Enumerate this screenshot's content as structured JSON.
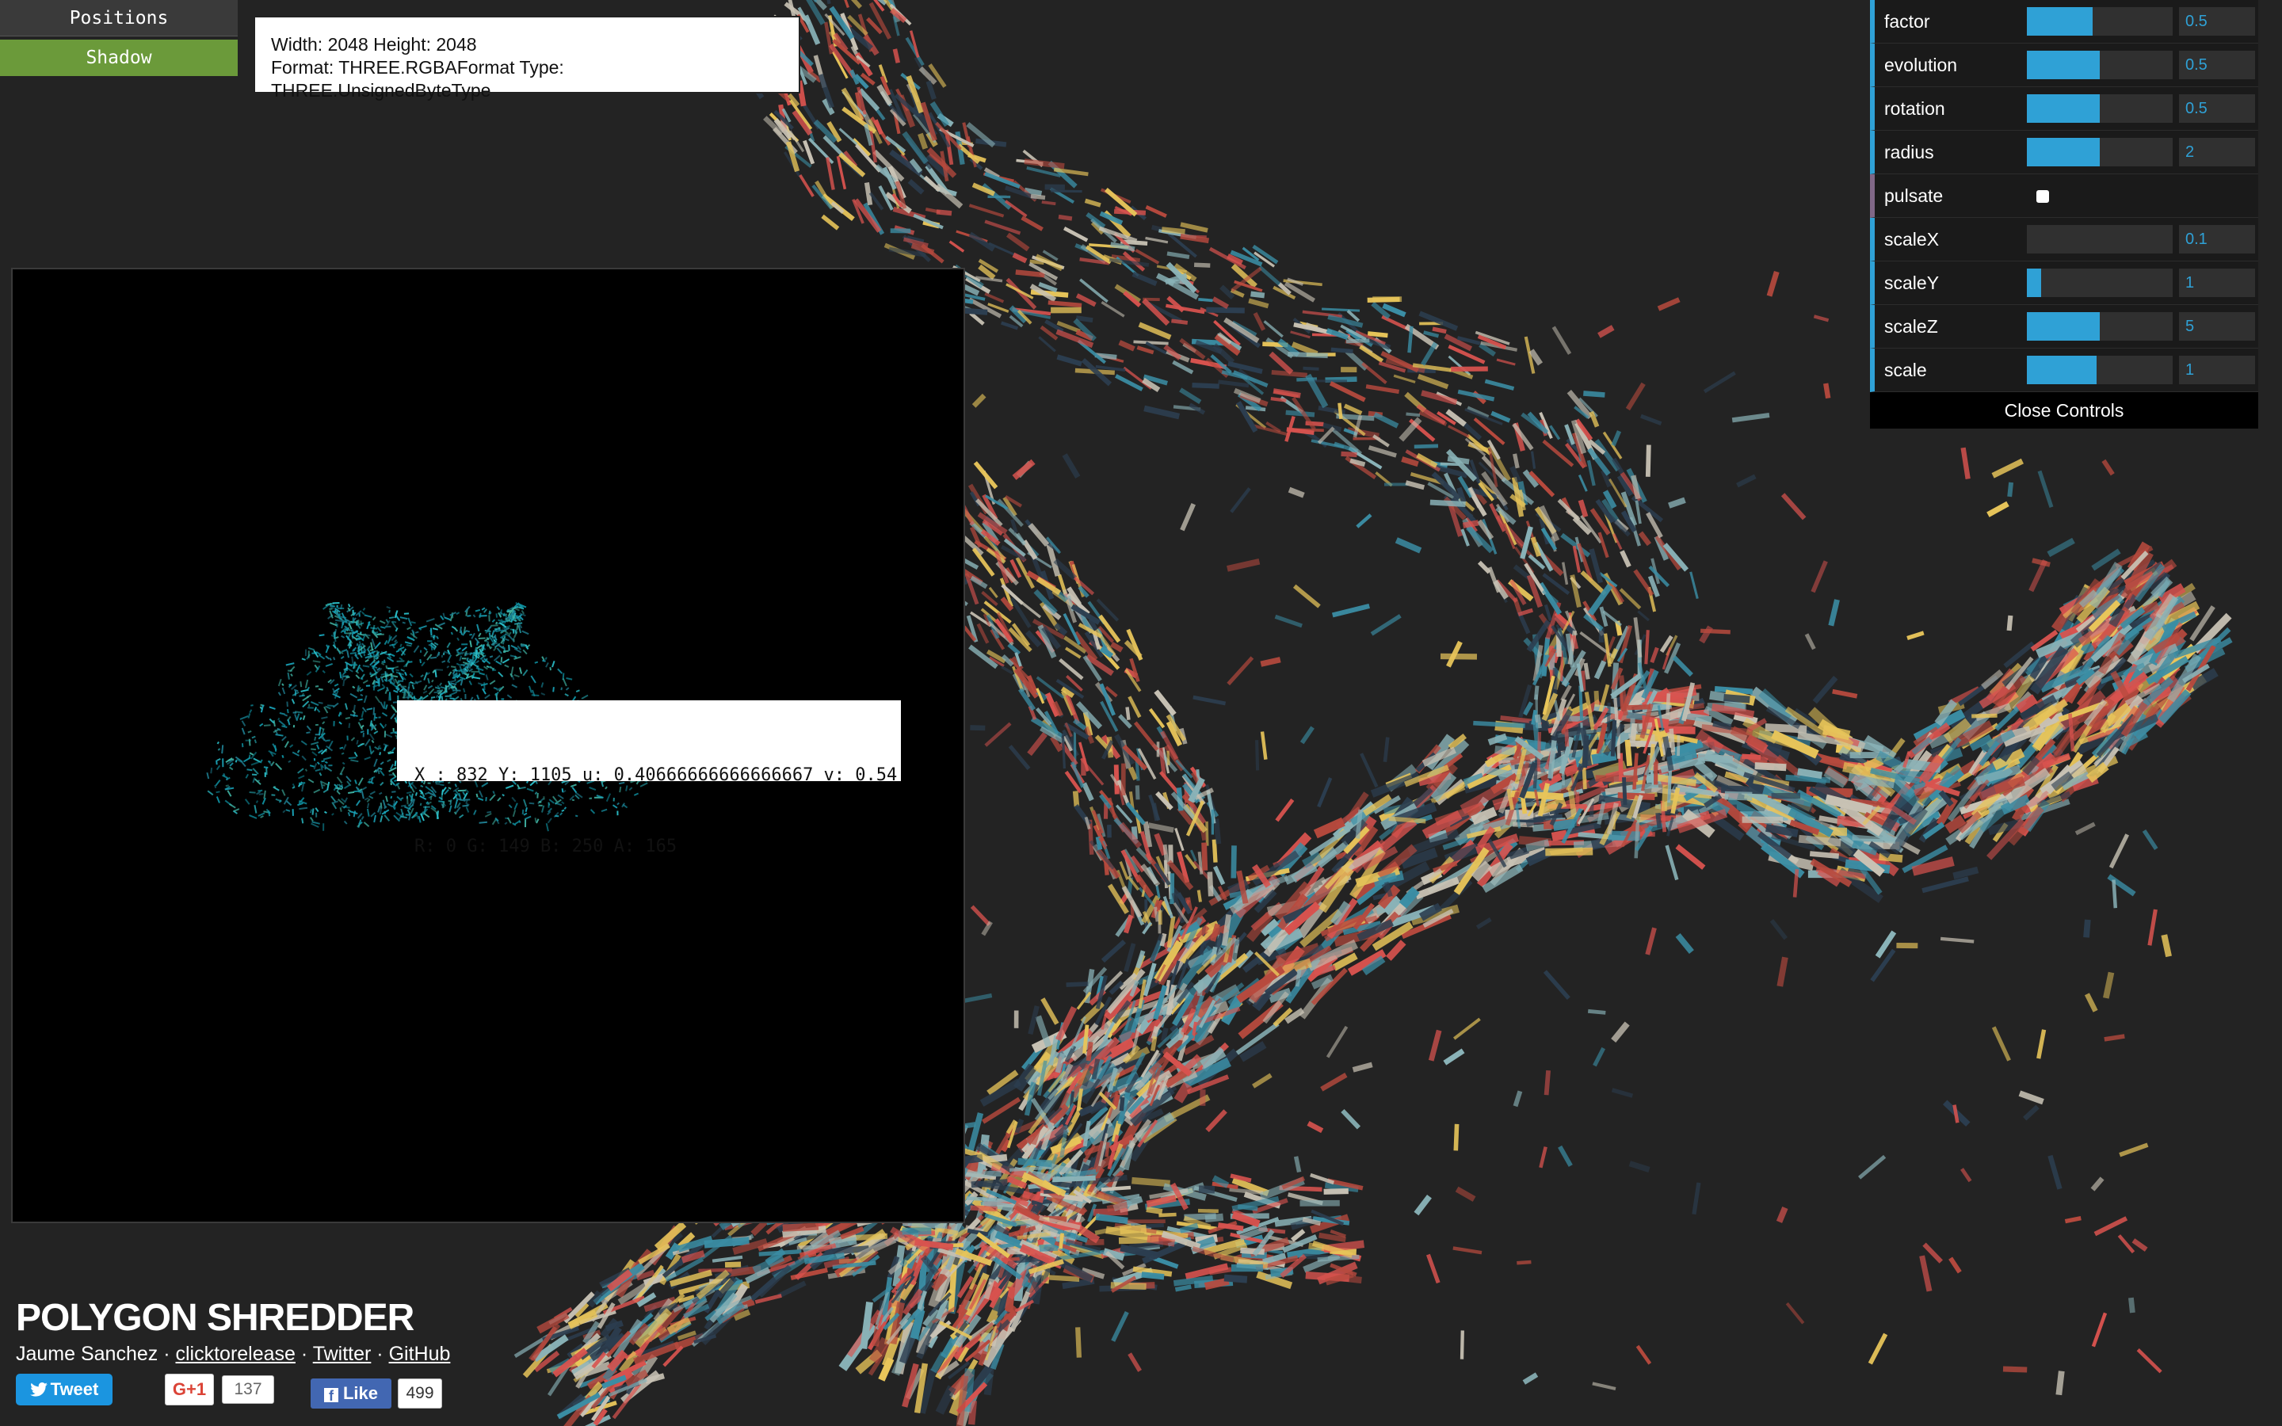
{
  "debug": {
    "positions_label": "Positions",
    "shadow_label": "Shadow",
    "info_line1": "Width: 2048 Height: 2048",
    "info_line2": "Format: THREE.RGBAFormat Type: THREE.UnsignedByteType",
    "pixel_line1": "X : 832 Y: 1105 u: 0.40666666666666667 v: 0.54",
    "pixel_line2": "R: 0 G: 149 B: 250 A: 165"
  },
  "controls": {
    "rows": [
      {
        "label": "factor",
        "value": "0.5",
        "fill": 0.45
      },
      {
        "label": "evolution",
        "value": "0.5",
        "fill": 0.5
      },
      {
        "label": "rotation",
        "value": "0.5",
        "fill": 0.5
      },
      {
        "label": "radius",
        "value": "2",
        "fill": 0.5
      },
      {
        "label": "pulsate",
        "checkbox": true
      },
      {
        "label": "scaleX",
        "value": "0.1",
        "fill": 0.0
      },
      {
        "label": "scaleY",
        "value": "1",
        "fill": 0.1
      },
      {
        "label": "scaleZ",
        "value": "5",
        "fill": 0.5
      },
      {
        "label": "scale",
        "value": "1",
        "fill": 0.48
      }
    ],
    "close_label": "Close Controls"
  },
  "footer": {
    "title": "POLYGON SHREDDER",
    "author": "Jaume Sanchez",
    "sep": " · ",
    "link1": "clicktorelease",
    "link2": "Twitter",
    "link3": "GitHub",
    "tweet_label": "Tweet",
    "gplus_label": "G+1",
    "gplus_count": "137",
    "fb_label": "Like",
    "fb_count": "499"
  },
  "colors": {
    "accent": "#2fa1d6",
    "bool_accent": "#806787",
    "shadow_button": "#6b9a3a",
    "background": "#232323",
    "ribbon_palette": [
      "#d9534f",
      "#3b8ea5",
      "#e8c55a",
      "#c9c3b5",
      "#2c3e50",
      "#8ab3b8",
      "#b84a3e"
    ]
  }
}
